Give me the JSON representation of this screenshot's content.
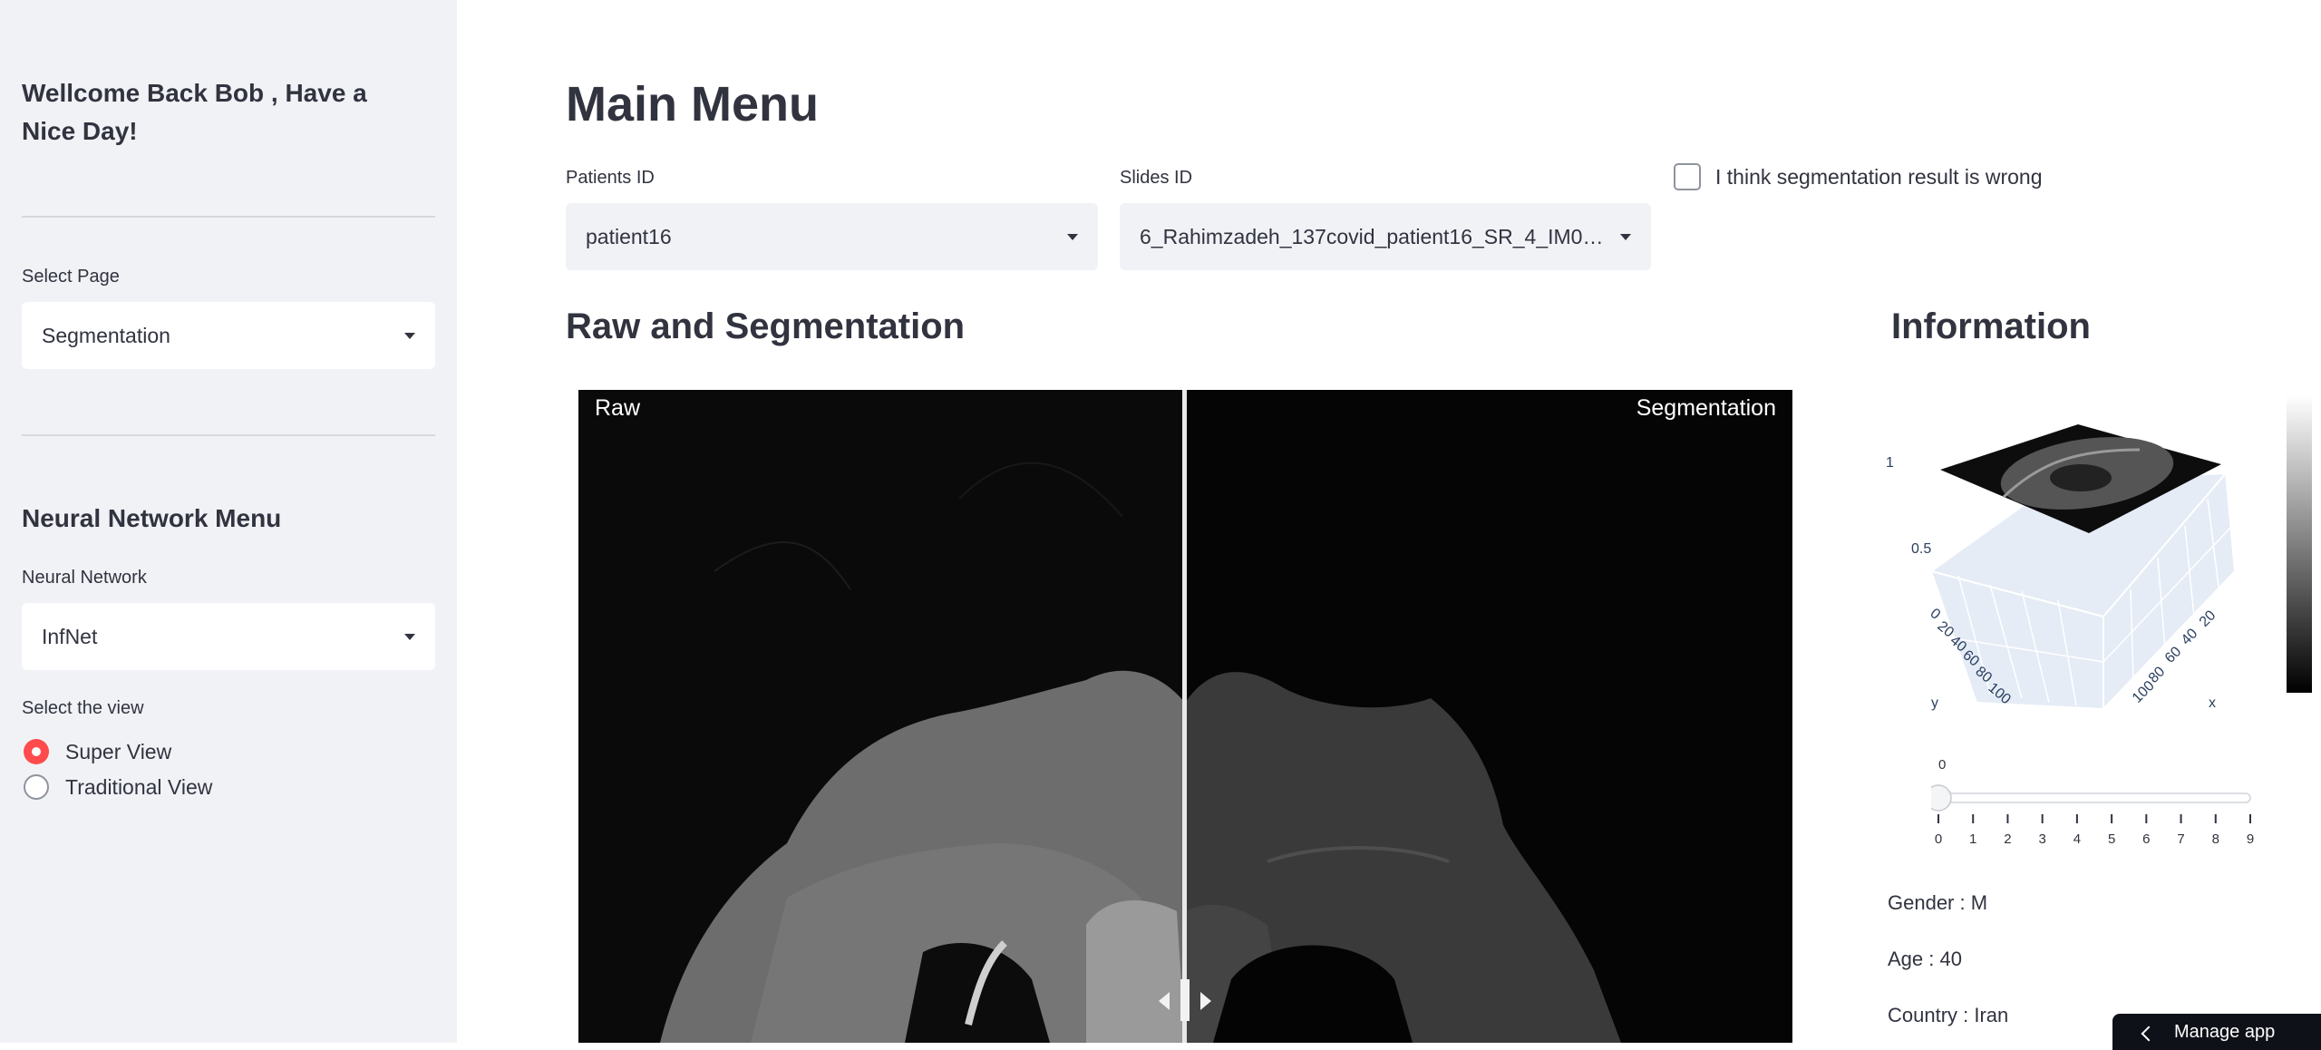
{
  "sidebar": {
    "welcome": "Wellcome Back Bob , Have a Nice Day!",
    "select_page_label": "Select Page",
    "select_page_value": "Segmentation",
    "nn_heading": "Neural Network Menu",
    "nn_label": "Neural Network",
    "nn_value": "InfNet",
    "view_label": "Select the view",
    "views": [
      "Super View",
      "Traditional View"
    ],
    "selected_view": "Super View"
  },
  "main": {
    "title": "Main Menu",
    "patients_label": "Patients ID",
    "patients_value": "patient16",
    "slides_label": "Slides ID",
    "slides_value": "6_Rahimzadeh_137covid_patient16_SR_4_IM00...",
    "wrong_checkbox_label": "I think segmentation result is wrong",
    "wrong_checked": false,
    "section_raw": "Raw and Segmentation",
    "raw_tag": "Raw",
    "seg_tag": "Segmentation",
    "section_info": "Information"
  },
  "plot3d": {
    "z_ticks": [
      "1",
      "0.5"
    ],
    "left_axis_ticks": [
      "0",
      "20",
      "40",
      "60",
      "80",
      "100"
    ],
    "right_axis_ticks": [
      "20",
      "40",
      "60",
      "80",
      "100"
    ],
    "x_axis_label": "x",
    "y_axis_label": "y",
    "colorbar": {
      "top_color": "#ffffff",
      "bottom_color": "#000000"
    }
  },
  "slider": {
    "current_value": "0",
    "ticks": [
      "0",
      "1",
      "2",
      "3",
      "4",
      "5",
      "6",
      "7",
      "8",
      "9"
    ],
    "value": 0
  },
  "info": {
    "gender": "Gender : M",
    "age": "Age : 40",
    "country": "Country : Iran"
  },
  "footer": {
    "manage_app": "Manage app"
  },
  "colors": {
    "accent": "#ff4b4b",
    "sidebar_bg": "#f0f2f6",
    "text": "#31333f"
  }
}
